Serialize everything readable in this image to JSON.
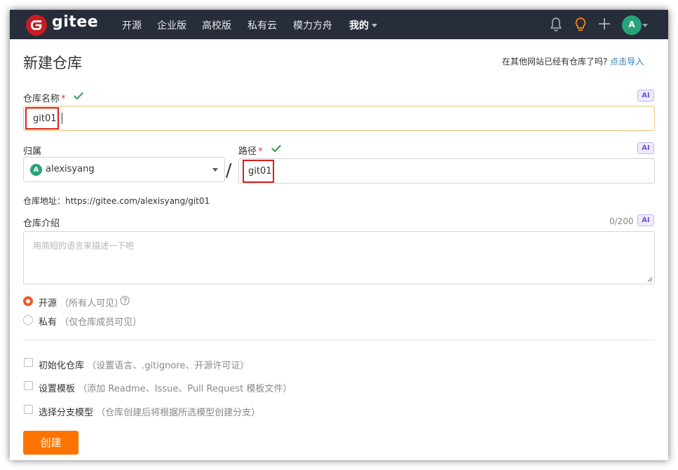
{
  "nav": {
    "logo_text": "gitee",
    "items": [
      "开源",
      "企业版",
      "高校版",
      "私有云",
      "模力方舟",
      "我的"
    ],
    "avatar_letter": "A"
  },
  "header": {
    "title": "新建仓库",
    "import_prompt": "在其他网站已经有仓库了吗?",
    "import_link": "点击导入"
  },
  "form": {
    "name_label": "仓库名称",
    "required_mark": "*",
    "ai_badge": "AI",
    "name_value": "git01",
    "owner_label": "归属",
    "owner_avatar_letter": "A",
    "owner_value": "alexisyang",
    "separator": "/",
    "path_label": "路径",
    "path_value": "git01",
    "repo_url": "仓库地址：https://gitee.com/alexisyang/git01",
    "desc_label": "仓库介绍",
    "desc_counter": "0/200",
    "desc_placeholder": "用简短的语言来描述一下吧",
    "visibility": [
      {
        "label": "开源",
        "hint": "（所有人可见）",
        "checked": true
      },
      {
        "label": "私有",
        "hint": "（仅仓库成员可见）",
        "checked": false
      }
    ],
    "options": [
      {
        "label": "初始化仓库",
        "hint": "（设置语言、.gitignore、开源许可证）",
        "checked": false
      },
      {
        "label": "设置模板",
        "hint": "（添加 Readme、Issue、Pull Request 模板文件）",
        "checked": false
      },
      {
        "label": "选择分支模型",
        "hint": "（仓库创建后将根据所选模型创建分支）",
        "checked": false
      }
    ],
    "submit_label": "创建"
  },
  "colors": {
    "nav_bg": "#272d3a",
    "brand_red": "#c71d23",
    "accent_orange": "#fe7300",
    "link_blue": "#2d7bbf",
    "check_green": "#3aa357",
    "annotation_red": "#e01b1b"
  },
  "icons": [
    "gitee-logo-icon",
    "bell-icon",
    "lightbulb-icon",
    "plus-icon",
    "checkmark-icon",
    "help-icon",
    "chevron-down-icon"
  ]
}
